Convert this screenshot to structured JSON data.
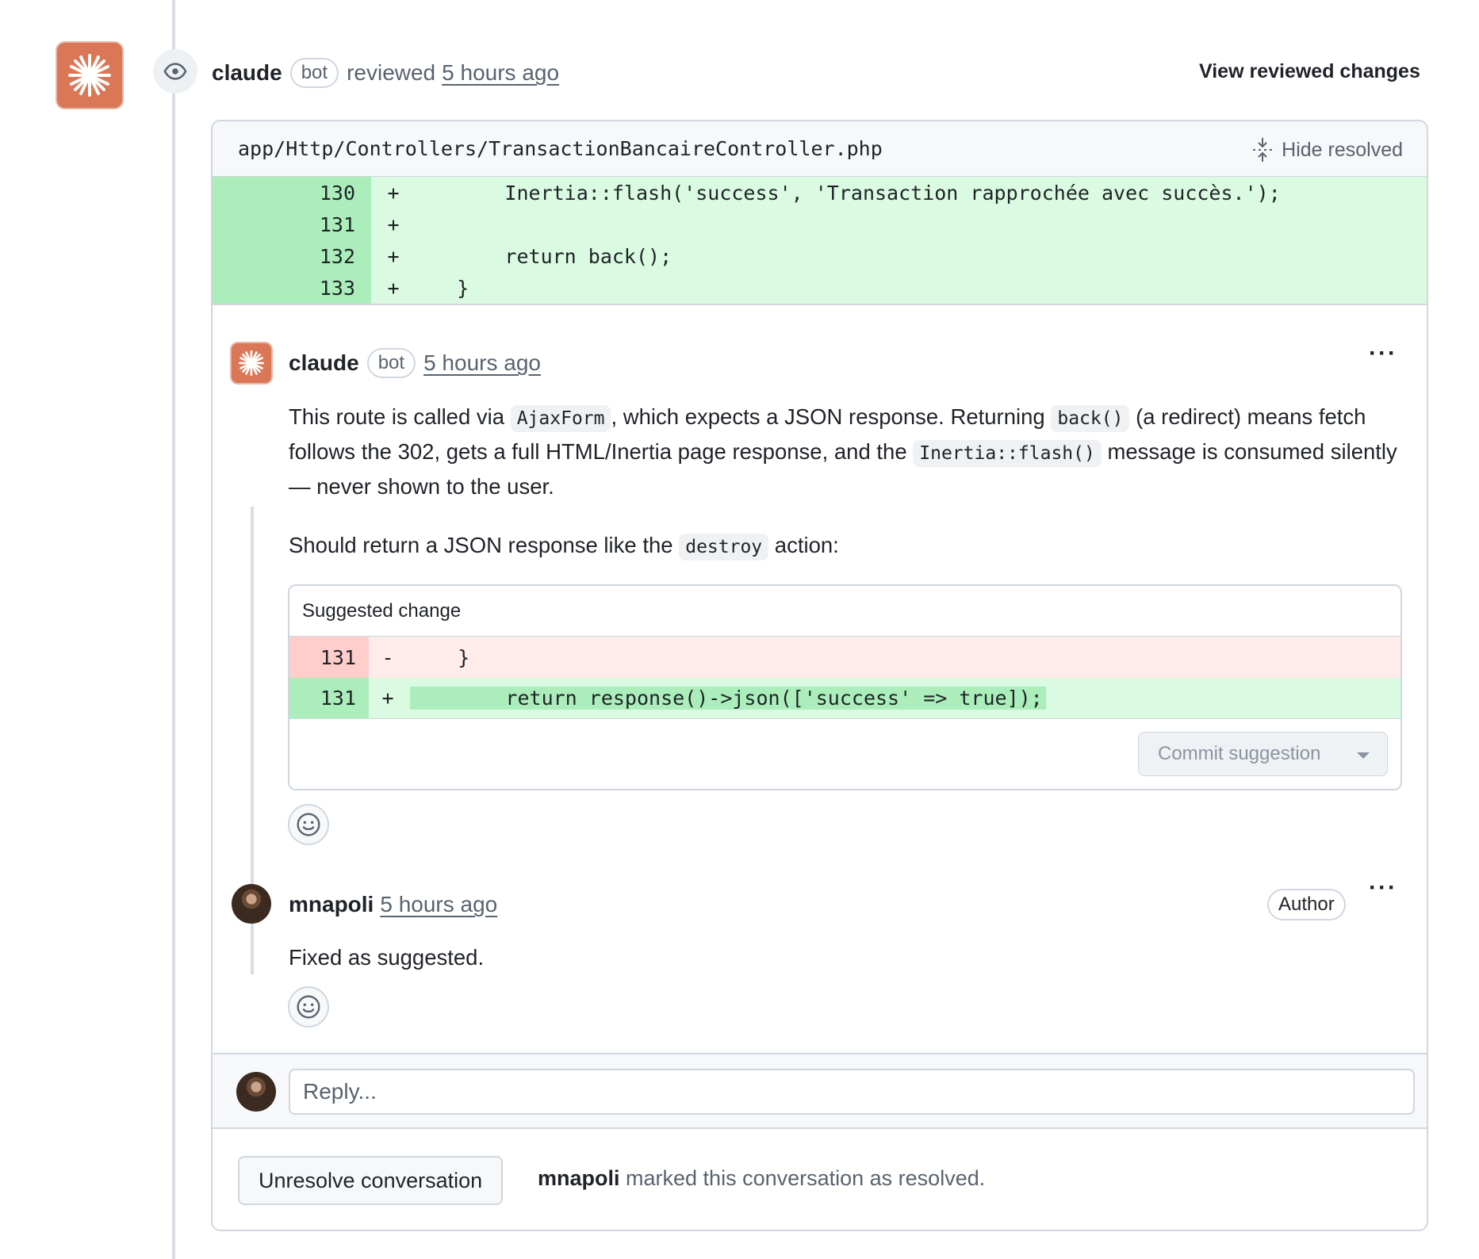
{
  "review": {
    "author": "claude",
    "bot_label": "bot",
    "action": "reviewed",
    "time": "5 hours ago",
    "view_changes": "View reviewed changes"
  },
  "file": {
    "path": "app/Http/Controllers/TransactionBancaireController.php",
    "hide_resolved": "Hide resolved",
    "lines": [
      {
        "num": "130",
        "sign": "+",
        "code": "        Inertia::flash('success', 'Transaction rapprochée avec succès.');"
      },
      {
        "num": "131",
        "sign": "+",
        "code": ""
      },
      {
        "num": "132",
        "sign": "+",
        "code": "        return back();"
      },
      {
        "num": "133",
        "sign": "+",
        "code": "    }"
      }
    ]
  },
  "comment1": {
    "author": "claude",
    "bot_label": "bot",
    "time": "5 hours ago",
    "menu": "···",
    "p1_a": "This route is called via ",
    "p1_code1": "AjaxForm",
    "p1_b": ", which expects a JSON response. Returning ",
    "p1_code2": "back()",
    "p1_c": " (a redirect) means fetch follows the 302, gets a full HTML/Inertia page response, and the ",
    "p1_code3": "Inertia::flash()",
    "p1_d": " message is consumed silently — never shown to the user.",
    "p2_a": "Should return a JSON response like the ",
    "p2_code": "destroy",
    "p2_b": " action:",
    "suggestion": {
      "title": "Suggested change",
      "del": {
        "num": "131",
        "sign": "-",
        "code": "    }"
      },
      "add": {
        "num": "131",
        "sign": "+",
        "code": "        return response()->json(['success' => true]);"
      },
      "commit_label": "Commit suggestion"
    }
  },
  "comment2": {
    "author": "mnapoli",
    "time": "5 hours ago",
    "badge": "Author",
    "menu": "···",
    "body": "Fixed as suggested."
  },
  "reply": {
    "placeholder": "Reply..."
  },
  "resolution": {
    "button": "Unresolve conversation",
    "user": "mnapoli",
    "text": " marked this conversation as resolved."
  },
  "colors": {
    "claude_brand": "#d97757",
    "diff_add": "#dafbe1",
    "diff_del": "#ffebe9"
  }
}
